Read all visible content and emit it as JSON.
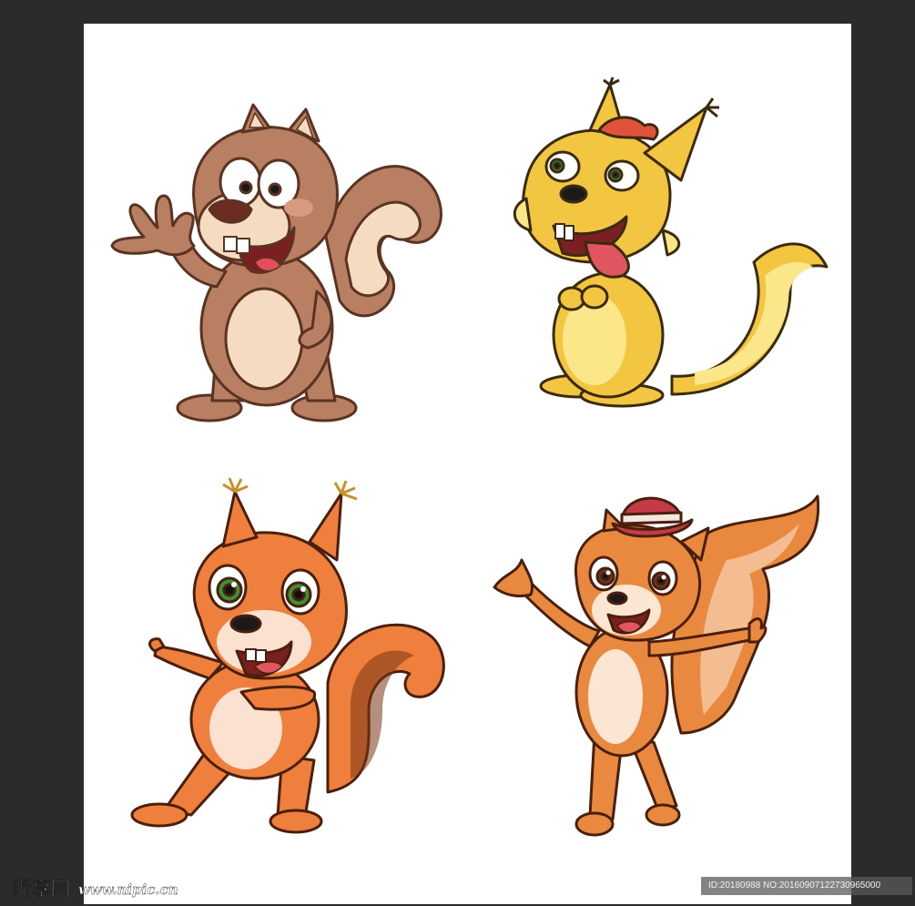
{
  "image": {
    "background": "#2b2b2b",
    "canvas_color": "#ffffff",
    "illustrations": [
      {
        "name": "brown-squirrel-waving",
        "colors": {
          "fur": "#b97f62",
          "belly": "#f5dcc0",
          "outline": "#5a3322"
        }
      },
      {
        "name": "yellow-squirrel-tongue-out",
        "colors": {
          "fur": "#f3c641",
          "belly": "#fbe68a",
          "tuft": "#e0533b",
          "outline": "#3a2a10"
        }
      },
      {
        "name": "orange-squirrel-dancing",
        "colors": {
          "fur": "#ee7f3c",
          "belly": "#fbe1cf",
          "eyes": "#3d8f3a",
          "outline": "#4a1f0c"
        }
      },
      {
        "name": "orange-squirrel-hat",
        "colors": {
          "fur": "#e98940",
          "belly": "#fbe5d3",
          "hat": "#c23b47",
          "outline": "#4a1f0c"
        }
      }
    ]
  },
  "watermark": {
    "logo_text": "昵享网 www.nipic.cn",
    "id_text": "ID:20180988 NO:20160907122730965000"
  }
}
